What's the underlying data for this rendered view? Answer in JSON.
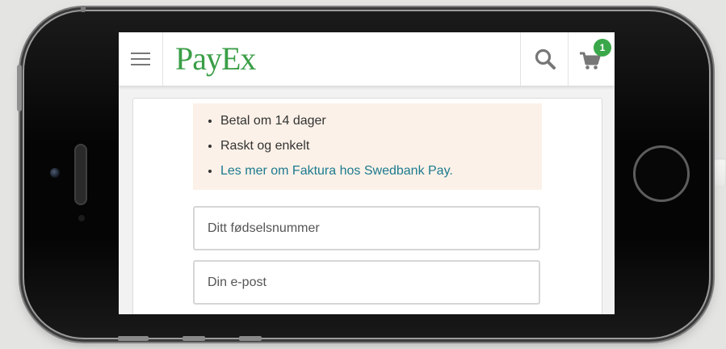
{
  "header": {
    "logo_text": "PayEx",
    "cart_count": "1",
    "icons": {
      "menu": "hamburger-menu-icon",
      "search": "search-icon",
      "cart": "shopping-cart-icon"
    }
  },
  "invoice_info": {
    "items": [
      "Betal om 14 dager",
      "Raskt og enkelt"
    ],
    "link_text": "Les mer om Faktura hos Swedbank Pay."
  },
  "form": {
    "ssn_placeholder": "Ditt fødselsnummer",
    "email_placeholder": "Din e-post"
  },
  "colors": {
    "brand_green": "#3a9e47",
    "badge_green": "#3aa84a",
    "info_background": "#fbf1e8",
    "link_color": "#1d7a8f"
  }
}
